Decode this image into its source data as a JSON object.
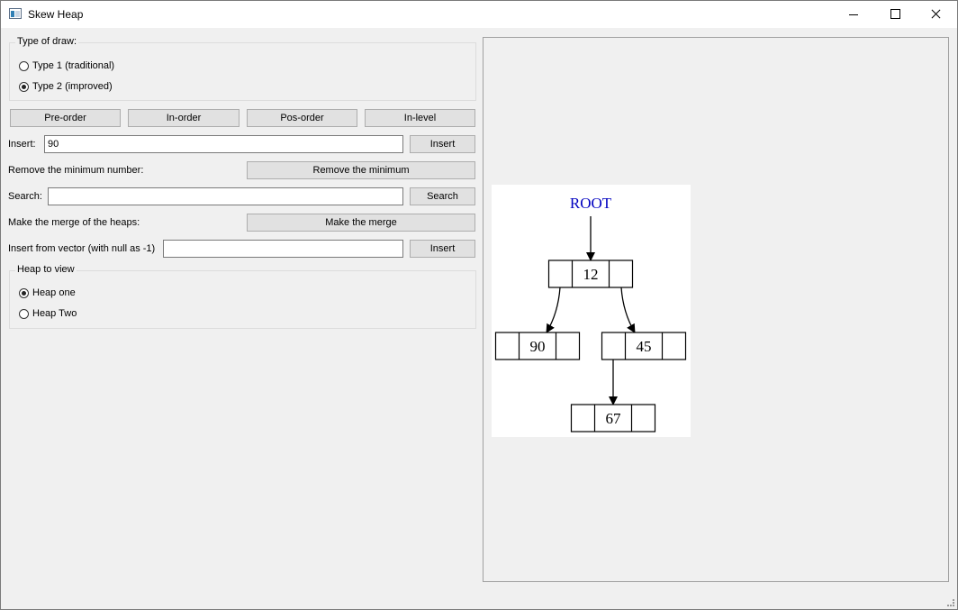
{
  "window": {
    "title": "Skew Heap",
    "icon": "app-window-icon",
    "controls": [
      "minimize-icon",
      "maximize-icon",
      "close-icon"
    ]
  },
  "draw_type": {
    "label": "Type of draw:",
    "options": [
      {
        "label": "Type 1 (traditional)",
        "checked": false
      },
      {
        "label": "Type 2 (improved)",
        "checked": true
      }
    ]
  },
  "traversal_buttons": [
    "Pre-order",
    "In-order",
    "Pos-order",
    "In-level"
  ],
  "insert": {
    "label": "Insert:",
    "value": "90",
    "button": "Insert"
  },
  "remove_min": {
    "label": "Remove the minimum number:",
    "button": "Remove the minimum"
  },
  "search": {
    "label": "Search:",
    "value": "",
    "button": "Search"
  },
  "merge": {
    "label": "Make the merge of the heaps:",
    "button": "Make the merge"
  },
  "insert_vector": {
    "label": "Insert from vector (with null as -1)",
    "value": "",
    "button": "Insert"
  },
  "heap_view": {
    "label": "Heap to view",
    "options": [
      {
        "label": "Heap one",
        "checked": true
      },
      {
        "label": "Heap Two",
        "checked": false
      }
    ]
  },
  "tree": {
    "root_label": "ROOT",
    "root_color": "#0000c0",
    "nodes": [
      {
        "id": "n12",
        "value": "12",
        "parent": null
      },
      {
        "id": "n90",
        "value": "90",
        "parent": "n12"
      },
      {
        "id": "n45",
        "value": "45",
        "parent": "n12"
      },
      {
        "id": "n67",
        "value": "67",
        "parent": "n45"
      }
    ]
  }
}
